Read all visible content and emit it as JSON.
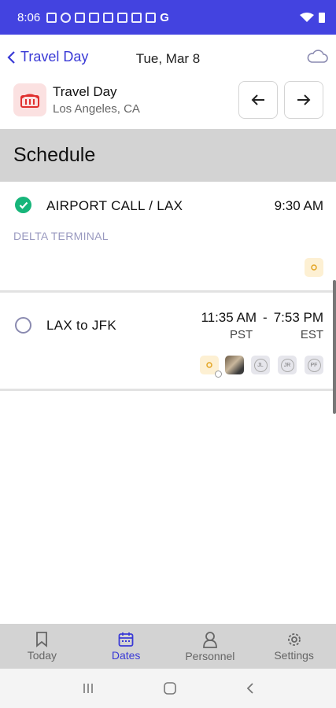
{
  "status_bar": {
    "time": "8:06"
  },
  "header": {
    "back_label": "Travel Day",
    "date": "Tue, Mar 8"
  },
  "event": {
    "title": "Travel Day",
    "location": "Los Angeles, CA"
  },
  "schedule": {
    "heading": "Schedule",
    "items": [
      {
        "title": "AIRPORT CALL / LAX",
        "time": "9:30 AM",
        "subtitle": "DELTA TERMINAL",
        "done": true
      },
      {
        "title": "LAX to JFK",
        "start_time": "11:35 AM",
        "separator": "-",
        "end_time": "7:53 PM",
        "start_tz": "PST",
        "end_tz": "EST",
        "done": false,
        "personnel": [
          "JL",
          "JR",
          "PF"
        ]
      }
    ]
  },
  "bottom_nav": {
    "tabs": [
      {
        "label": "Today",
        "icon": "bookmark-icon"
      },
      {
        "label": "Dates",
        "icon": "calendar-icon",
        "active": true
      },
      {
        "label": "Personnel",
        "icon": "person-icon"
      },
      {
        "label": "Settings",
        "icon": "gear-icon"
      }
    ]
  },
  "colors": {
    "accent": "#3a3ad6",
    "status_bar": "#4343e0",
    "success": "#17b57a",
    "warning": "#e3a524"
  }
}
